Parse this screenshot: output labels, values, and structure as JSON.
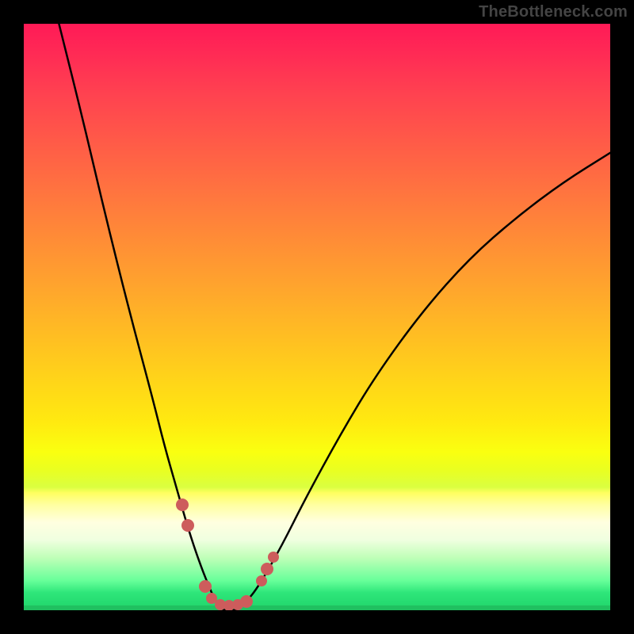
{
  "watermark": "TheBottleneck.com",
  "colors": {
    "page_bg": "#000000",
    "watermark": "#444444",
    "curve": "#000000",
    "marker": "#cd5c5c",
    "gradient_top": "#ff1a56",
    "gradient_bottom": "#20d46a"
  },
  "chart_data": {
    "type": "line",
    "title": "",
    "xlabel": "",
    "ylabel": "",
    "xlim": [
      0,
      100
    ],
    "ylim": [
      0,
      100
    ],
    "grid": false,
    "legend": false,
    "note": "Bottleneck-style V curve with gradient heatmap background; axis values not labeled in source image — x is a relative performance ratio axis, y is bottleneck severity (0 = no bottleneck). Curve y-values estimated from pixel positions.",
    "series": [
      {
        "name": "bottleneck-curve",
        "x": [
          6,
          10,
          14,
          18,
          22,
          24,
          26,
          28,
          30,
          32,
          33,
          34,
          35,
          36,
          37,
          38,
          40,
          44,
          48,
          54,
          60,
          68,
          76,
          84,
          92,
          100
        ],
        "y": [
          100,
          84,
          67,
          51,
          36,
          28,
          21,
          14,
          8,
          3,
          1,
          0,
          0,
          0,
          0.5,
          1.5,
          4,
          11,
          19,
          30,
          40,
          51,
          60,
          67,
          73,
          78
        ]
      }
    ],
    "markers": [
      {
        "x": 27.0,
        "y": 18.0,
        "size": "big"
      },
      {
        "x": 28.0,
        "y": 14.5,
        "size": "big"
      },
      {
        "x": 31.0,
        "y": 4.0,
        "size": "big"
      },
      {
        "x": 32.0,
        "y": 2.0,
        "size": "normal"
      },
      {
        "x": 33.5,
        "y": 1.0,
        "size": "normal"
      },
      {
        "x": 35.0,
        "y": 0.8,
        "size": "normal"
      },
      {
        "x": 36.5,
        "y": 1.0,
        "size": "normal"
      },
      {
        "x": 38.0,
        "y": 1.5,
        "size": "big"
      },
      {
        "x": 40.5,
        "y": 5.0,
        "size": "normal"
      },
      {
        "x": 41.5,
        "y": 7.0,
        "size": "big"
      },
      {
        "x": 42.5,
        "y": 9.0,
        "size": "normal"
      }
    ]
  }
}
